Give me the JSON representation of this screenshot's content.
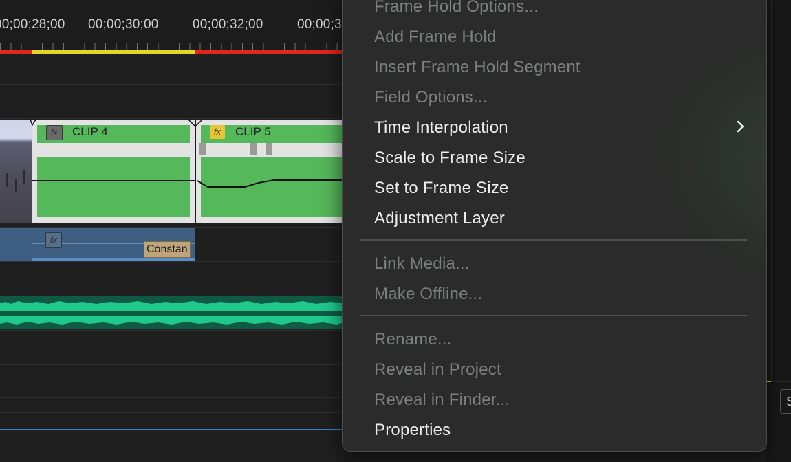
{
  "timeline": {
    "timecodes": [
      "00;00;28;00",
      "00;00;30;00",
      "00;00;32;00",
      "00;00;3"
    ],
    "clips": {
      "clip4": {
        "name": "CLIP 4",
        "fx": "fx"
      },
      "clip5": {
        "name": "CLIP 5",
        "fx": "fx"
      },
      "adjustment_label": "Constan",
      "adjustment_fx": "fx"
    },
    "colors": {
      "work_area_red": "#e0261f",
      "work_area_yellow": "#e3d427",
      "clip_green": "#55b85a",
      "audio_green": "#1ec98b"
    }
  },
  "context_menu": {
    "items": [
      {
        "label": "Frame Hold Options...",
        "enabled": false
      },
      {
        "label": "Add Frame Hold",
        "enabled": false
      },
      {
        "label": "Insert Frame Hold Segment",
        "enabled": false
      },
      {
        "label": "Field Options...",
        "enabled": false
      },
      {
        "label": "Time Interpolation",
        "enabled": true,
        "submenu": true
      },
      {
        "label": "Scale to Frame Size",
        "enabled": true
      },
      {
        "label": "Set to Frame Size",
        "enabled": true
      },
      {
        "label": "Adjustment Layer",
        "enabled": true
      },
      {
        "label": "Link Media...",
        "enabled": false
      },
      {
        "label": "Make Offline...",
        "enabled": false
      },
      {
        "label": "Rename...",
        "enabled": false
      },
      {
        "label": "Reveal in Project",
        "enabled": false
      },
      {
        "label": "Reveal in Finder...",
        "enabled": false
      },
      {
        "label": "Properties",
        "enabled": true
      }
    ],
    "submenu_icon": "chevron-right-icon"
  },
  "right_panel": {
    "partial_text": "S"
  }
}
